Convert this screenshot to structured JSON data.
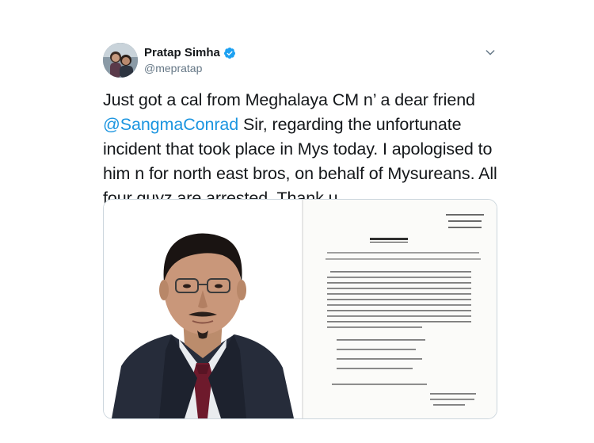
{
  "author": {
    "display_name": "Pratap Simha",
    "handle": "@mepratap",
    "avatar_icon": "avatar-photo",
    "verified_icon": "verified-badge-icon"
  },
  "menu": {
    "icon": "chevron-down-icon"
  },
  "tweet": {
    "text_part1": "Just got a cal from Meghalaya CM n’ a dear friend ",
    "mention": "@SangmaConrad",
    "text_part2": " Sir, regarding the unfortunate incident that took place in Mys today. I apologised to him n for north east bros, on behalf of Mysureans. All four guyz are arrested. Thank u."
  },
  "media": {
    "photo_label": "portrait-photo",
    "document_label": "press-release-document"
  },
  "colors": {
    "link": "#1b95e0",
    "text": "#14171a",
    "secondary": "#657786",
    "border": "#ccd6dd"
  }
}
